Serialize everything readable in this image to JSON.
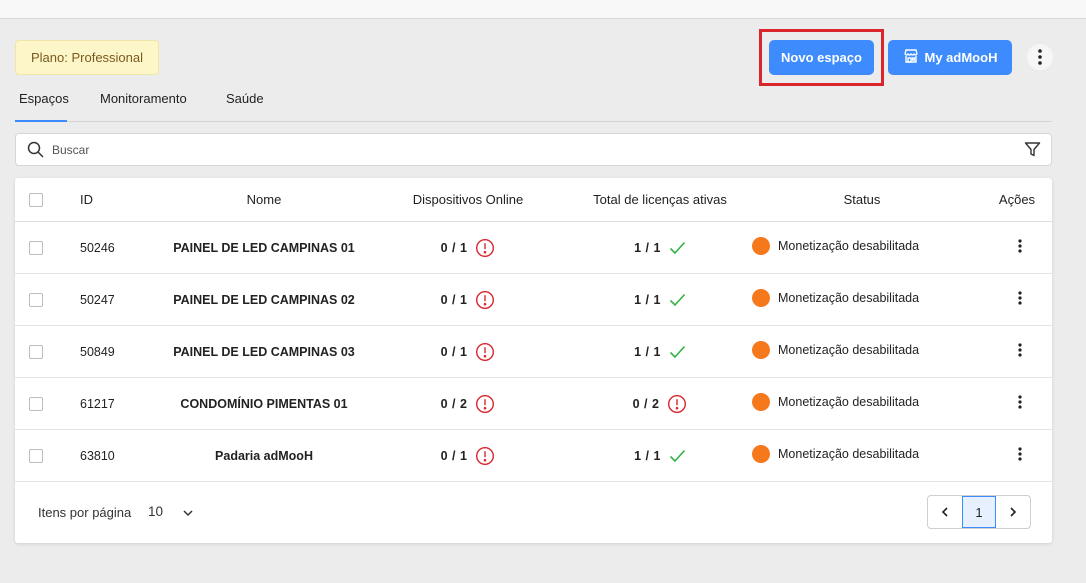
{
  "plan_badge": "Plano: Professional",
  "actions": {
    "new_space": "Novo espaço",
    "my_admooh": "My adMooH"
  },
  "tabs": [
    {
      "label": "Espaços",
      "active": true
    },
    {
      "label": "Monitoramento",
      "active": false
    },
    {
      "label": "Saúde",
      "active": false
    }
  ],
  "search": {
    "placeholder": "Buscar",
    "value": ""
  },
  "table": {
    "headers": {
      "id": "ID",
      "nome": "Nome",
      "dispositivos": "Dispositivos Online",
      "licencas": "Total de licenças ativas",
      "status": "Status",
      "acoes": "Ações"
    },
    "rows": [
      {
        "id": "50246",
        "nome": "PAINEL DE LED CAMPINAS 01",
        "dispositivos": "0 / 1",
        "dispositivos_ok": false,
        "licencas": "1 / 1",
        "licencas_ok": true,
        "status": "Monetização desabilitada"
      },
      {
        "id": "50247",
        "nome": "PAINEL DE LED CAMPINAS 02",
        "dispositivos": "0 / 1",
        "dispositivos_ok": false,
        "licencas": "1 / 1",
        "licencas_ok": true,
        "status": "Monetização desabilitada"
      },
      {
        "id": "50849",
        "nome": "PAINEL DE LED CAMPINAS 03",
        "dispositivos": "0 / 1",
        "dispositivos_ok": false,
        "licencas": "1 / 1",
        "licencas_ok": true,
        "status": "Monetização desabilitada"
      },
      {
        "id": "61217",
        "nome": "CONDOMÍNIO PIMENTAS 01",
        "dispositivos": "0 / 2",
        "dispositivos_ok": false,
        "licencas": "0 / 2",
        "licencas_ok": false,
        "status": "Monetização desabilitada"
      },
      {
        "id": "63810",
        "nome": "Padaria adMooH",
        "dispositivos": "0 / 1",
        "dispositivos_ok": false,
        "licencas": "1 / 1",
        "licencas_ok": true,
        "status": "Monetização desabilitada"
      }
    ]
  },
  "pagination": {
    "items_per_page_label": "Itens por página",
    "items_per_page": "10",
    "current_page": "1"
  },
  "colors": {
    "primary": "#3d8bfd",
    "warning_dot": "#f5791a",
    "error": "#d9262c",
    "success": "#2fb344",
    "plan_badge_bg": "#fdf6c8"
  }
}
